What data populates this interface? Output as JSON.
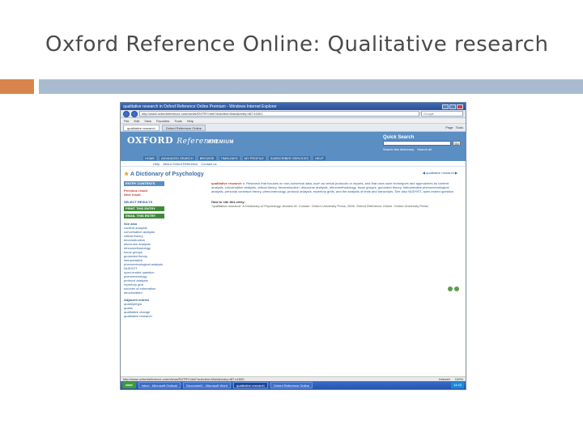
{
  "slide": {
    "title": "Oxford Reference Online: Qualitative research"
  },
  "browser": {
    "window_title": "qualitative research in Oxford Reference Online Premium - Windows Internet Explorer",
    "url": "http://www.oxfordreference.com/views/ENTRY.html?subview=Main&entry=t87.e1601",
    "search_placeholder": "Google",
    "menu": [
      "File",
      "Edit",
      "View",
      "Favorites",
      "Tools",
      "Help"
    ],
    "tabs": [
      "qualitative research",
      "Oxford Reference Online"
    ],
    "tools": [
      "Page",
      "Tools"
    ]
  },
  "site": {
    "logo": "OXFORD",
    "logo_sub": "Reference",
    "logo_small": "ONLINE",
    "edition": "PREMIUM",
    "quick_search_label": "Quick Search",
    "go_label": "Go",
    "search_options": [
      "Search this dictionary",
      "Search all"
    ],
    "nav_items": [
      "HOME",
      "ADVANCED SEARCH",
      "BROWSE",
      "TIMELINES",
      "MY PROFILE",
      "SUBSCRIBER SERVICES",
      "HELP"
    ],
    "subnav": [
      "Help",
      "About Oxford Reference",
      "Contact us"
    ]
  },
  "page": {
    "book_title": "A Dictionary of Psychology",
    "nav_prev_next": "qualitative research",
    "left": {
      "entry_button": "ENTRY CONTENTS",
      "prev": "Previous result",
      "next": "Next result",
      "select_results": "SELECT RESULTS",
      "print_button": "PRINT THIS ENTRY",
      "email_button": "EMAIL THIS ENTRY",
      "see_also_head": "See also",
      "see_also": [
        "content analysis",
        "conversation analysis",
        "critical theory",
        "deconstruction",
        "discourse analysis",
        "ethnomethodology",
        "focus groups",
        "grounded theory",
        "interpretative phenomenological analysis",
        "NUD*IST",
        "open-ended question",
        "phenomenology",
        "protocol analysis",
        "repertory grid",
        "sources of information",
        "structuralism"
      ],
      "adjacent_head": "Adjacent entries",
      "adjacent": [
        "quadriplegia",
        "qualia",
        "qualitative change",
        "qualitative research"
      ]
    },
    "entry_term": "qualitative research",
    "entry_body": "n. Research that focuses on non-numerical data, such as verbal protocols or reports, and that uses such techniques and approaches as content analysis, conversation analysis, critical theory, deconstruction, discourse analysis, ethnomethodology, focus groups, grounded theory, interpretative phenomenological analysis, personal construct theory, phenomenology, protocol analysis, repertory grids, and the analysis of texts and transcripts. See also NUD*IST, open-ended question.",
    "cite_head": "How to cite this entry:",
    "cite_body": "\"qualitative research\" A Dictionary of Psychology. Andrew M. Colman. Oxford University Press, 2006. Oxford Reference Online. Oxford University Press."
  },
  "status": {
    "url": "http://www.oxfordreference.com/views/ENTRY.html?subview=Main&entry=t87.e1600",
    "zone": "Internet",
    "zoom": "100%"
  },
  "taskbar": {
    "start": "start",
    "tasks": [
      "Inbox - Microsoft Outlook",
      "Document1 - Microsoft Word",
      "qualitative research",
      "Oxford Reference Online"
    ],
    "clock": "14:42"
  }
}
